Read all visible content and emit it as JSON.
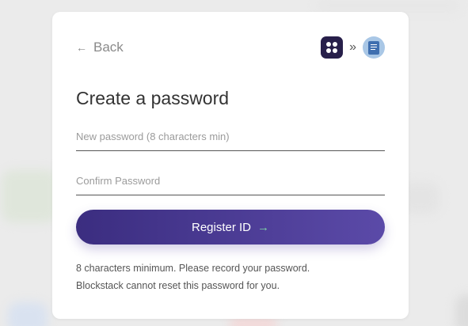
{
  "back_label": "Back",
  "title": "Create a password",
  "fields": {
    "new_password": {
      "placeholder": "New password (8 characters min)",
      "value": ""
    },
    "confirm_password": {
      "placeholder": "Confirm Password",
      "value": ""
    }
  },
  "register_label": "Register ID",
  "note_line_1": "8 characters minimum. Please record your password.",
  "note_line_2": "Blockstack cannot reset this password for you.",
  "icons": {
    "app_logo": "blockstack-logo-icon",
    "separator": "double-chevron-right-icon",
    "target_app": "document-app-icon"
  },
  "colors": {
    "button_start": "#3b2d80",
    "button_end": "#5b4aa8",
    "logo_bg": "#271f4a",
    "arrow_accent": "#7fd6a6"
  }
}
